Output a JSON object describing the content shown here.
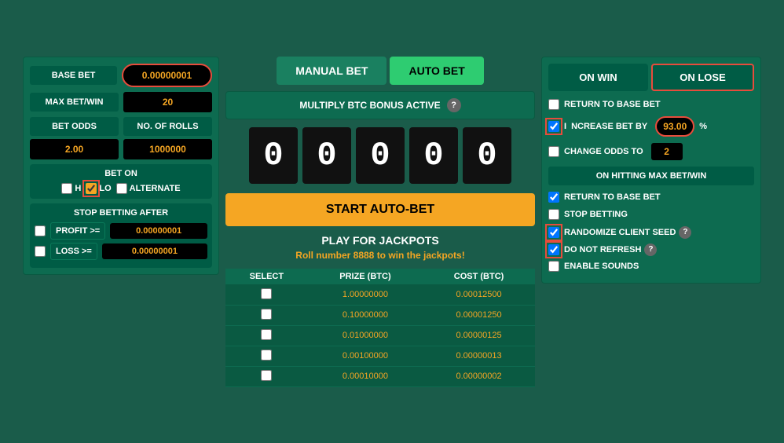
{
  "tabs": {
    "manual": "MANUAL BET",
    "auto": "AUTO BET",
    "active": "auto"
  },
  "bonus": {
    "text": "MULTIPLY BTC BONUS ACTIVE",
    "help": "?"
  },
  "left": {
    "base_bet_label": "BASE BET",
    "base_bet_value": "0.00000001",
    "max_bet_label": "MAX BET/WIN",
    "max_bet_value": "20",
    "bet_odds_label": "BET ODDS",
    "bet_odds_value": "2.00",
    "no_rolls_label": "NO. OF ROLLS",
    "no_rolls_value": "1000000",
    "bet_on_title": "BET ON",
    "hi_label": "H",
    "lo_label": "LO",
    "alternate_label": "ALTERNATE",
    "stop_title": "STOP BETTING AFTER",
    "profit_label": "PROFIT >=",
    "profit_value": "0.00000001",
    "loss_label": "LOSS >=",
    "loss_value": "0.00000001"
  },
  "scoreboard": {
    "digits": [
      "0",
      "0",
      "0",
      "0",
      "0"
    ]
  },
  "start_btn": "START AUTO-BET",
  "jackpot": {
    "title": "PLAY FOR JACKPOTS",
    "subtitle": "Roll number",
    "number": "8888",
    "subtitle2": "to win the jackpots!",
    "headers": [
      "SELECT",
      "PRIZE (BTC)",
      "COST (BTC)"
    ],
    "rows": [
      {
        "prize": "1.00000000",
        "cost": "0.00012500"
      },
      {
        "prize": "0.10000000",
        "cost": "0.00001250"
      },
      {
        "prize": "0.01000000",
        "cost": "0.00000125"
      },
      {
        "prize": "0.00100000",
        "cost": "0.00000013"
      },
      {
        "prize": "0.00010000",
        "cost": "0.00000002"
      }
    ]
  },
  "right": {
    "on_win_label": "ON WIN",
    "on_lose_label": "ON LOSE",
    "return_base_label": "RETURN TO BASE BET",
    "increase_label": "NCREASE BET BY",
    "increase_value": "93.00",
    "percent": "%",
    "change_odds_label": "CHANGE ODDS TO",
    "change_odds_value": "2",
    "max_section_label": "ON HITTING MAX BET/WIN",
    "max_return_label": "RETURN TO BASE BET",
    "max_stop_label": "STOP BETTING",
    "randomize_label": "RANDOMIZE CLIENT SEED",
    "randomize_help": "?",
    "do_not_refresh_label": "DO NOT REFRESH",
    "do_not_refresh_help": "?",
    "enable_sounds_label": "ENABLE SOUNDS"
  }
}
